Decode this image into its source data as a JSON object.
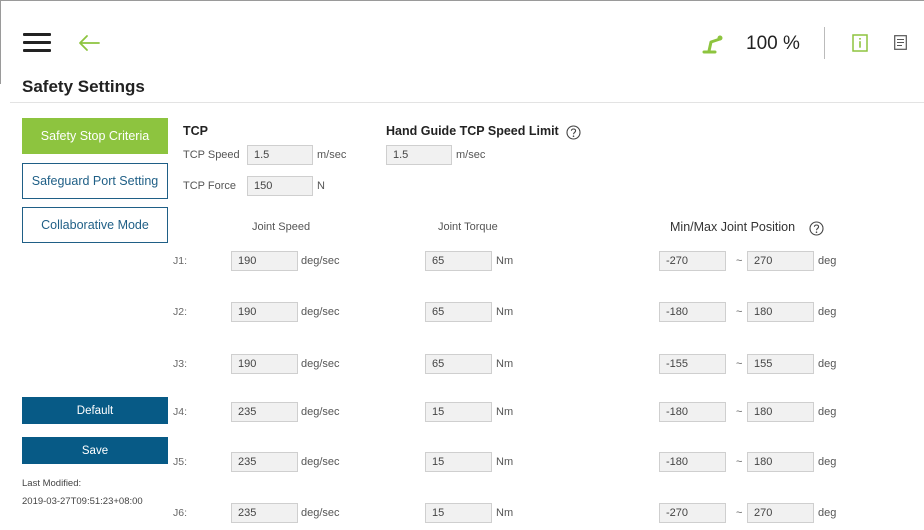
{
  "header": {
    "speed_percent": "100 %",
    "page_title": "Safety Settings"
  },
  "sidebar": {
    "items": [
      {
        "label": "Safety Stop Criteria",
        "active": true
      },
      {
        "label": "Safeguard Port Setting",
        "active": false
      },
      {
        "label": "Collaborative Mode",
        "active": false
      }
    ],
    "default_label": "Default",
    "save_label": "Save",
    "last_modified_label": "Last Modified:",
    "last_modified_value": "2019-03-27T09:51:23+08:00"
  },
  "tcp": {
    "title": "TCP",
    "speed_label": "TCP Speed",
    "speed_value": "1.5",
    "speed_unit": "m/sec",
    "force_label": "TCP Force",
    "force_value": "150",
    "force_unit": "N"
  },
  "hand_guide": {
    "title": "Hand Guide TCP Speed Limit",
    "value": "1.5",
    "unit": "m/sec"
  },
  "joints": {
    "speed_header": "Joint Speed",
    "torque_header": "Joint Torque",
    "position_header": "Min/Max Joint Position",
    "speed_unit": "deg/sec",
    "torque_unit": "Nm",
    "position_unit": "deg",
    "separator": "~",
    "rows": [
      {
        "label": "J1:",
        "speed": "190",
        "torque": "65",
        "min": "-270",
        "max": "270"
      },
      {
        "label": "J2:",
        "speed": "190",
        "torque": "65",
        "min": "-180",
        "max": "180"
      },
      {
        "label": "J3:",
        "speed": "190",
        "torque": "65",
        "min": "-155",
        "max": "155"
      },
      {
        "label": "J4:",
        "speed": "235",
        "torque": "15",
        "min": "-180",
        "max": "180"
      },
      {
        "label": "J5:",
        "speed": "235",
        "torque": "15",
        "min": "-180",
        "max": "180"
      },
      {
        "label": "J6:",
        "speed": "235",
        "torque": "15",
        "min": "-270",
        "max": "270"
      }
    ]
  },
  "colors": {
    "accent_green": "#8dc43f",
    "primary_blue": "#075a86"
  },
  "icons": [
    "menu-icon",
    "back-arrow-icon",
    "robot-arm-icon",
    "info-icon",
    "log-icon",
    "help-icon"
  ]
}
